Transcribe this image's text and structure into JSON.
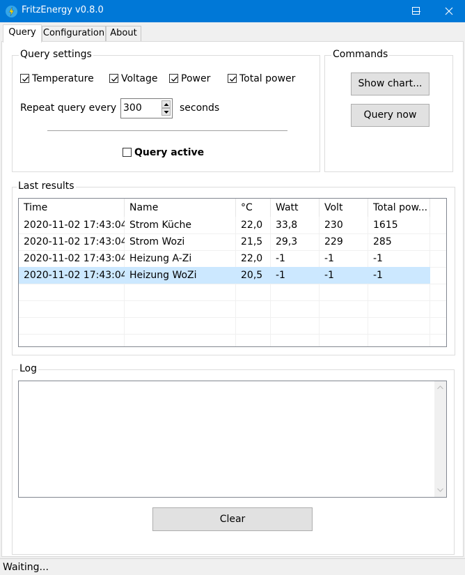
{
  "window": {
    "title": "FritzEnergy v0.8.0",
    "icon": "lightning-icon",
    "controls": [
      "minimize-icon",
      "maximize-icon",
      "close-icon"
    ]
  },
  "tabs": [
    {
      "label": "Query",
      "active": true
    },
    {
      "label": "Configuration",
      "active": false
    },
    {
      "label": "About",
      "active": false
    }
  ],
  "query_settings": {
    "caption": "Query settings",
    "checkboxes": [
      {
        "label": "Temperature",
        "checked": true
      },
      {
        "label": "Voltage",
        "checked": true
      },
      {
        "label": "Power",
        "checked": true
      },
      {
        "label": "Total power",
        "checked": true
      }
    ],
    "repeat_label": "Repeat query every",
    "repeat_value": "300",
    "repeat_unit": "seconds",
    "query_active_label": "Query active",
    "query_active_checked": false
  },
  "commands": {
    "caption": "Commands",
    "show_chart": "Show chart...",
    "query_now": "Query now"
  },
  "results": {
    "caption": "Last results",
    "columns": [
      "Time",
      "Name",
      "°C",
      "Watt",
      "Volt",
      "Total pow..."
    ],
    "rows": [
      [
        "2020-11-02 17:43:04",
        "Strom Küche",
        "22,0",
        "33,8",
        "230",
        "1615"
      ],
      [
        "2020-11-02 17:43:04",
        "Strom Wozi",
        "21,5",
        "29,3",
        "229",
        "285"
      ],
      [
        "2020-11-02 17:43:04",
        "Heizung A-Zi",
        "22,0",
        "-1",
        "-1",
        "-1"
      ],
      [
        "2020-11-02 17:43:04",
        "Heizung WoZi",
        "20,5",
        "-1",
        "-1",
        "-1"
      ]
    ],
    "selected_row": 3
  },
  "log": {
    "caption": "Log",
    "content": "",
    "clear_label": "Clear"
  },
  "status": {
    "text": "Waiting..."
  },
  "colors": {
    "titlebar": "#0078d7",
    "selection": "#cce8ff",
    "window_bg": "#f0f0f0"
  }
}
